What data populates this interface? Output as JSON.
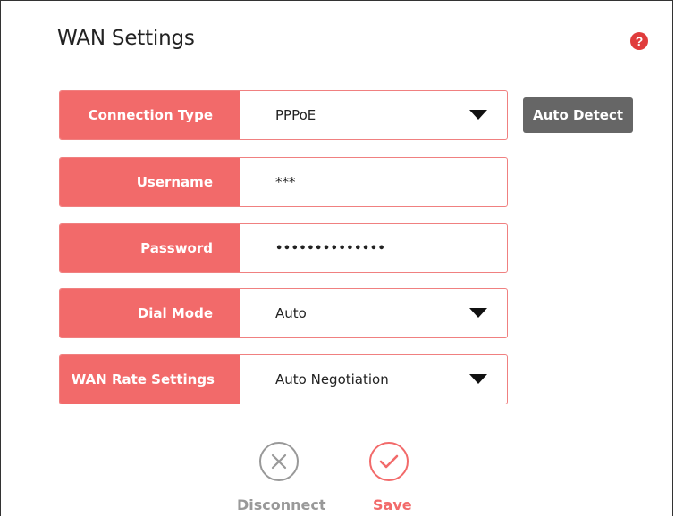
{
  "header": {
    "title": "WAN Settings"
  },
  "auto_detect_label": "Auto Detect",
  "fields": [
    {
      "label": "Connection Type",
      "value": "PPPoE",
      "dropdown": true
    },
    {
      "label": "Username",
      "value": "***",
      "dropdown": false
    },
    {
      "label": "Password",
      "value": "••••••••••••••",
      "dropdown": false
    },
    {
      "label": "Dial Mode",
      "value": "Auto",
      "dropdown": true
    },
    {
      "label": "WAN Rate Settings",
      "value": "Auto Negotiation",
      "dropdown": true
    }
  ],
  "actions": {
    "disconnect_label": "Disconnect",
    "save_label": "Save"
  },
  "colors": {
    "accent": "#f26a6a",
    "button_gray": "#666666",
    "disconnect_gray": "#999999",
    "help_red": "#e03c3c"
  },
  "icons": {
    "help": "question-circle-icon",
    "dropdown": "triangle-down-icon",
    "disconnect": "x-circle-icon",
    "save": "check-circle-icon"
  }
}
